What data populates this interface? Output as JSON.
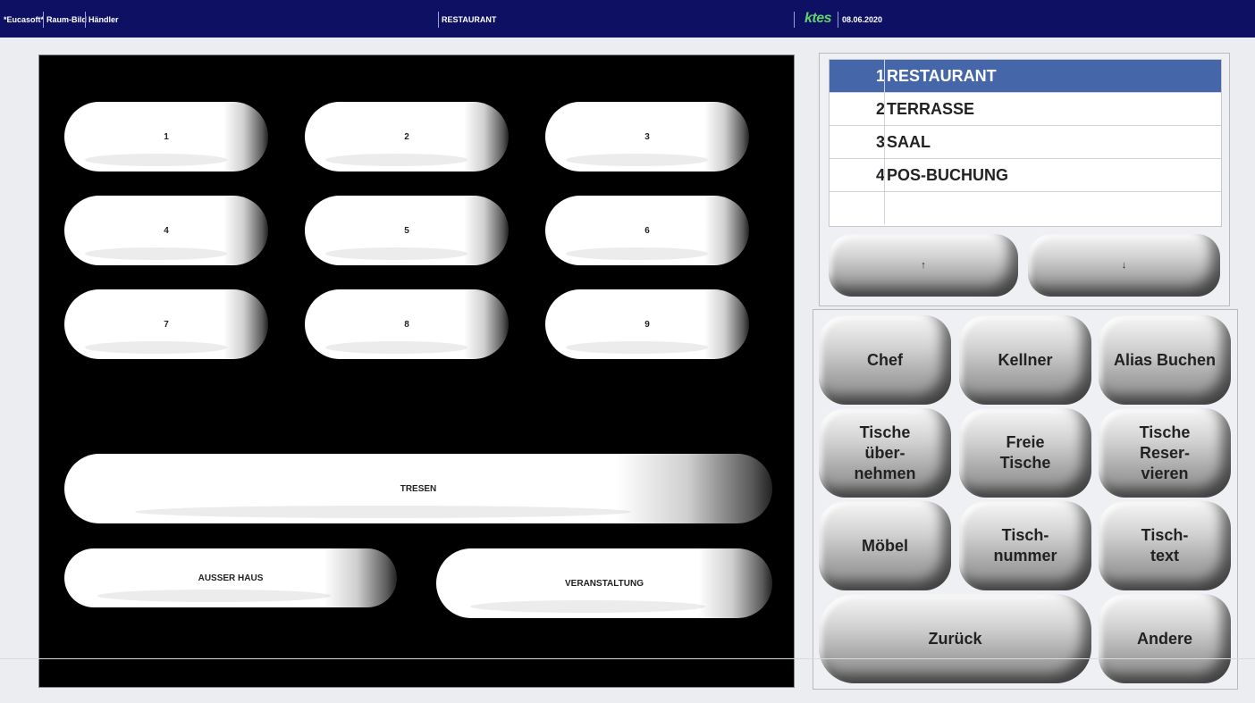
{
  "topbar": {
    "app": "*Eucasoft*",
    "module": "Raum-Bild",
    "user": "Händler",
    "room": "RESTAURANT",
    "logo": "ktes",
    "date": "08.06.2020"
  },
  "floor": {
    "tables": [
      "1",
      "2",
      "3",
      "4",
      "5",
      "6",
      "7",
      "8",
      "9"
    ],
    "counter": "TRESEN",
    "takeaway": "AUSSER HAUS",
    "event": "VERANSTALTUNG"
  },
  "rooms": [
    {
      "num": "1",
      "name": "RESTAURANT",
      "selected": true
    },
    {
      "num": "2",
      "name": "TERRASSE",
      "selected": false
    },
    {
      "num": "3",
      "name": "SAAL",
      "selected": false
    },
    {
      "num": "4",
      "name": "POS-BUCHUNG",
      "selected": false
    }
  ],
  "nav": {
    "up": "↑",
    "down": "↓"
  },
  "actions": {
    "chef": "Chef",
    "kellner": "Kellner",
    "alias": "Alias Buchen",
    "uebernehmen": "Tische über- nehmen",
    "freie": "Freie Tische",
    "reservieren": "Tische Reser- vieren",
    "moebel": "Möbel",
    "tischnummer": "Tisch- nummer",
    "tischtext": "Tisch- text",
    "zurueck": "Zurück",
    "andere": "Andere"
  },
  "colors": {
    "topbar": "#0e1163",
    "selected_row": "#4566a8",
    "floor_bg": "#000000"
  }
}
